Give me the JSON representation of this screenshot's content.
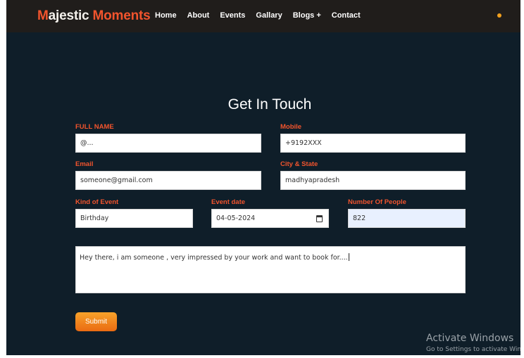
{
  "brand": {
    "m": "M",
    "rest": "ajestic ",
    "moments": "Moments"
  },
  "nav": {
    "items": [
      "Home",
      "About",
      "Events",
      "Gallary",
      "Blogs +",
      "Contact"
    ]
  },
  "form": {
    "title": "Get In Touch",
    "full_name": {
      "label": "FULL NAME",
      "value": "@..."
    },
    "mobile": {
      "label": "Mobile",
      "value": "+9192XXX"
    },
    "email": {
      "label": "Email",
      "value": "someone@gmail.com"
    },
    "city_state": {
      "label": "City & State",
      "value": "madhyapradesh"
    },
    "kind_of_event": {
      "label": "Kind of Event",
      "value": "Birthday"
    },
    "event_date": {
      "label": "Event date",
      "value": "04-05-2024"
    },
    "number_of_people": {
      "label": "Number Of People",
      "value": "822"
    },
    "message": {
      "value": "Hey there, i am someone , very impressed by your work and want to book for...."
    },
    "submit_label": "Submit"
  },
  "watermark": {
    "title": "Activate Windows",
    "subtitle": "Go to Settings to activate Windows."
  },
  "colors": {
    "accent": "#f2542d",
    "page_bg": "#0f1e29",
    "nav_bg": "#201d1b",
    "button": "#f28a1e"
  }
}
